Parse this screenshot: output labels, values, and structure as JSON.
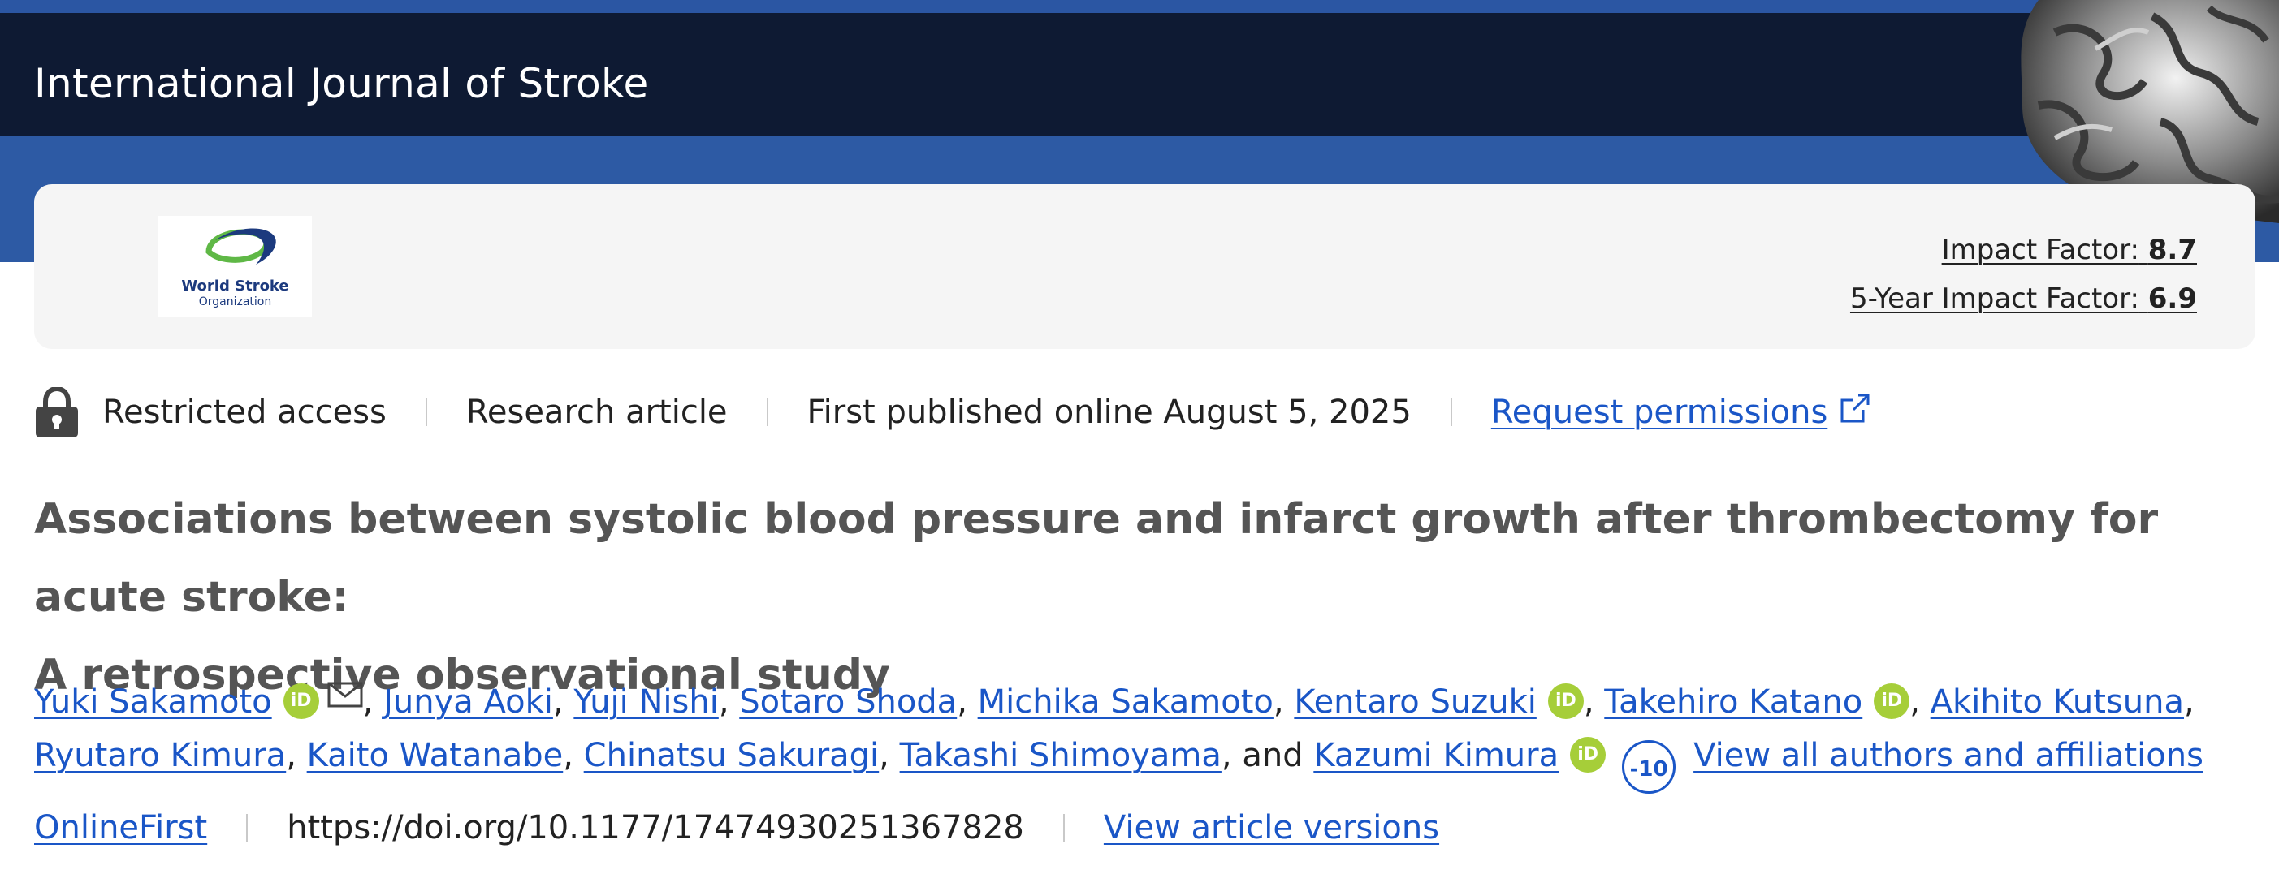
{
  "header": {
    "journal_title": "International Journal of Stroke"
  },
  "society_logo": {
    "name": "World Stroke",
    "subname": "Organization"
  },
  "metrics": {
    "impact_factor_label": "Impact Factor:",
    "impact_factor_value": "8.7",
    "five_year_label": "5-Year Impact Factor:",
    "five_year_value": "6.9"
  },
  "meta": {
    "access": "Restricted access",
    "type": "Research article",
    "published": "First published online August 5, 2025",
    "permissions": "Request permissions"
  },
  "article": {
    "title_line1": "Associations between systolic blood pressure and infarct growth after thrombectomy for acute stroke:",
    "title_line2": "A retrospective observational study"
  },
  "authors": {
    "list": [
      "Yuki Sakamoto",
      "Junya Aoki",
      "Yuji Nishi",
      "Sotaro Shoda",
      "Michika Sakamoto",
      "Kentaro Suzuki",
      "Takehiro Katano",
      "Akihito Kutsuna",
      "Ryutaro Kimura",
      "Kaito Watanabe",
      "Chinatsu Sakuragi",
      "Takashi Shimoyama",
      "Kazumi Kimura"
    ],
    "and_text": "and",
    "more_count": "-10",
    "view_all": "View all authors and affiliations",
    "orcid_text": "iD"
  },
  "footer_meta": {
    "status": "OnlineFirst",
    "doi": "https://doi.org/10.1177/17474930251367828",
    "versions": "View article versions"
  },
  "icons": {
    "lock": "lock-icon",
    "external": "external-link-icon",
    "mail": "mail-icon",
    "orcid": "orcid-icon"
  },
  "colors": {
    "link": "#1a56c7",
    "header_dark": "#0e1a33",
    "header_blue": "#2d5aa4",
    "orcid": "#a6ce39"
  }
}
